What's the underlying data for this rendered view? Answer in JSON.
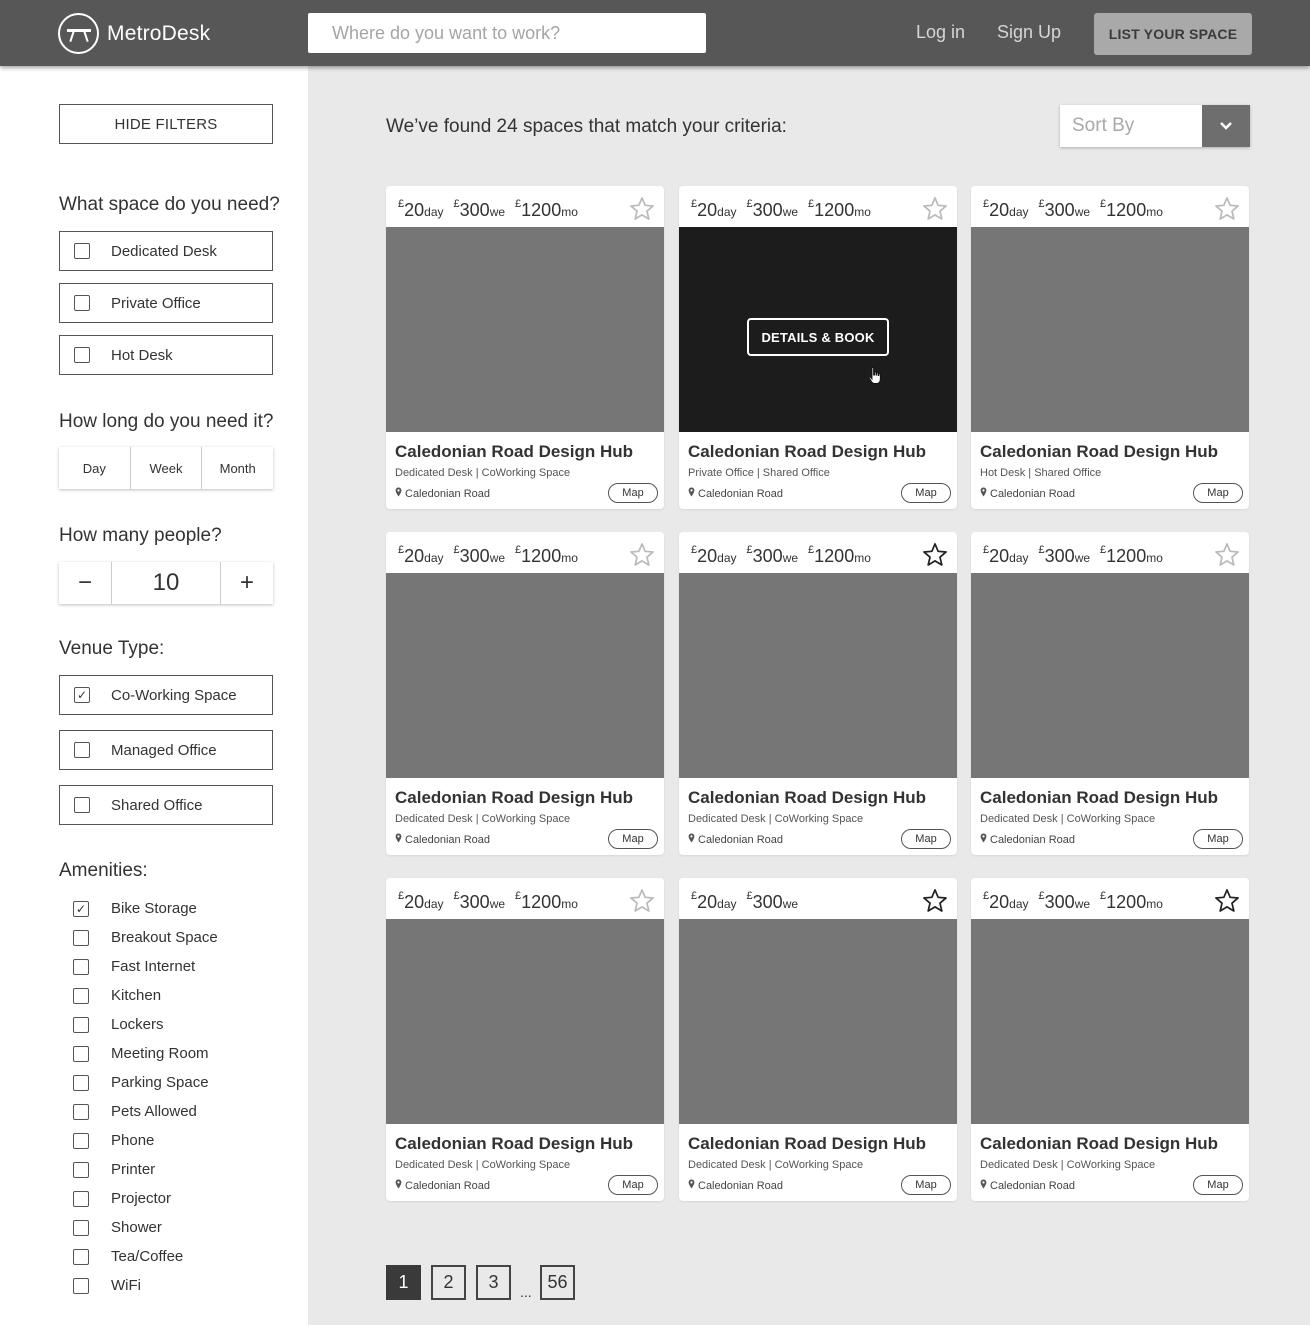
{
  "header": {
    "brand": "MetroDesk",
    "search_placeholder": "Where do you want to work?",
    "login_label": "Log in",
    "signup_label": "Sign Up",
    "list_space_label": "LIST YOUR SPACE"
  },
  "sidebar": {
    "hide_filters_label": "HIDE FILTERS",
    "space_title": "What space do you need?",
    "space_options": [
      {
        "label": "Dedicated Desk",
        "checked": false
      },
      {
        "label": "Private Office",
        "checked": false
      },
      {
        "label": "Hot Desk",
        "checked": false
      }
    ],
    "duration_title": "How long do you need it?",
    "duration_options": [
      "Day",
      "Week",
      "Month"
    ],
    "people_title": "How many people?",
    "people_minus": "−",
    "people_value": "10",
    "people_plus": "+",
    "venue_title": "Venue Type:",
    "venue_options": [
      {
        "label": "Co-Working Space",
        "checked": true
      },
      {
        "label": "Managed Office",
        "checked": false
      },
      {
        "label": "Shared Office",
        "checked": false
      }
    ],
    "amenities_title": "Amenities:",
    "amenities": [
      {
        "label": "Bike Storage",
        "checked": true
      },
      {
        "label": "Breakout Space",
        "checked": false
      },
      {
        "label": "Fast Internet",
        "checked": false
      },
      {
        "label": "Kitchen",
        "checked": false
      },
      {
        "label": "Lockers",
        "checked": false
      },
      {
        "label": "Meeting Room",
        "checked": false
      },
      {
        "label": "Parking Space",
        "checked": false
      },
      {
        "label": "Pets Allowed",
        "checked": false
      },
      {
        "label": "Phone",
        "checked": false
      },
      {
        "label": "Printer",
        "checked": false
      },
      {
        "label": "Projector",
        "checked": false
      },
      {
        "label": "Shower",
        "checked": false
      },
      {
        "label": "Tea/Coffee",
        "checked": false
      },
      {
        "label": "WiFi",
        "checked": false
      }
    ]
  },
  "main": {
    "results_heading": "We’ve found 24 spaces that match your criteria:",
    "sort_label": "Sort By",
    "cards": [
      {
        "title": "Caledonian Road Design Hub",
        "subtitle": "Dedicated Desk | CoWorking Space",
        "location": "Caledonian Road",
        "map_label": "Map",
        "starred": false,
        "hover": false,
        "prices": [
          {
            "currency": "£",
            "amount": "20",
            "unit": "day"
          },
          {
            "currency": "£",
            "amount": "300",
            "unit": "we"
          },
          {
            "currency": "£",
            "amount": "1200",
            "unit": "mo"
          }
        ]
      },
      {
        "title": "Caledonian Road Design Hub",
        "subtitle": "Private Office | Shared Office",
        "location": "Caledonian Road",
        "map_label": "Map",
        "starred": false,
        "hover": true,
        "details_label": "DETAILS & BOOK",
        "prices": [
          {
            "currency": "£",
            "amount": "20",
            "unit": "day"
          },
          {
            "currency": "£",
            "amount": "300",
            "unit": "we"
          },
          {
            "currency": "£",
            "amount": "1200",
            "unit": "mo"
          }
        ]
      },
      {
        "title": "Caledonian Road Design Hub",
        "subtitle": "Hot Desk | Shared Office",
        "location": "Caledonian Road",
        "map_label": "Map",
        "starred": false,
        "hover": false,
        "prices": [
          {
            "currency": "£",
            "amount": "20",
            "unit": "day"
          },
          {
            "currency": "£",
            "amount": "300",
            "unit": "we"
          },
          {
            "currency": "£",
            "amount": "1200",
            "unit": "mo"
          }
        ]
      },
      {
        "title": "Caledonian Road Design Hub",
        "subtitle": "Dedicated Desk | CoWorking Space",
        "location": "Caledonian Road",
        "map_label": "Map",
        "starred": false,
        "hover": false,
        "prices": [
          {
            "currency": "£",
            "amount": "20",
            "unit": "day"
          },
          {
            "currency": "£",
            "amount": "300",
            "unit": "we"
          },
          {
            "currency": "£",
            "amount": "1200",
            "unit": "mo"
          }
        ]
      },
      {
        "title": "Caledonian Road Design Hub",
        "subtitle": "Dedicated Desk | CoWorking Space",
        "location": "Caledonian Road",
        "map_label": "Map",
        "starred": true,
        "hover": false,
        "prices": [
          {
            "currency": "£",
            "amount": "20",
            "unit": "day"
          },
          {
            "currency": "£",
            "amount": "300",
            "unit": "we"
          },
          {
            "currency": "£",
            "amount": "1200",
            "unit": "mo"
          }
        ]
      },
      {
        "title": "Caledonian Road Design Hub",
        "subtitle": "Dedicated Desk | CoWorking Space",
        "location": "Caledonian Road",
        "map_label": "Map",
        "starred": false,
        "hover": false,
        "prices": [
          {
            "currency": "£",
            "amount": "20",
            "unit": "day"
          },
          {
            "currency": "£",
            "amount": "300",
            "unit": "we"
          },
          {
            "currency": "£",
            "amount": "1200",
            "unit": "mo"
          }
        ]
      },
      {
        "title": "Caledonian Road Design Hub",
        "subtitle": "Dedicated Desk | CoWorking Space",
        "location": "Caledonian Road",
        "map_label": "Map",
        "starred": false,
        "hover": false,
        "prices": [
          {
            "currency": "£",
            "amount": "20",
            "unit": "day"
          },
          {
            "currency": "£",
            "amount": "300",
            "unit": "we"
          },
          {
            "currency": "£",
            "amount": "1200",
            "unit": "mo"
          }
        ]
      },
      {
        "title": "Caledonian Road Design Hub",
        "subtitle": "Dedicated Desk | CoWorking Space",
        "location": "Caledonian Road",
        "map_label": "Map",
        "starred": true,
        "hover": false,
        "prices": [
          {
            "currency": "£",
            "amount": "20",
            "unit": "day"
          },
          {
            "currency": "£",
            "amount": "300",
            "unit": "we"
          }
        ]
      },
      {
        "title": "Caledonian Road Design Hub",
        "subtitle": "Dedicated Desk | CoWorking Space",
        "location": "Caledonian Road",
        "map_label": "Map",
        "starred": true,
        "hover": false,
        "prices": [
          {
            "currency": "£",
            "amount": "20",
            "unit": "day"
          },
          {
            "currency": "£",
            "amount": "300",
            "unit": "we"
          },
          {
            "currency": "£",
            "amount": "1200",
            "unit": "mo"
          }
        ]
      }
    ],
    "pagination": {
      "pages": [
        "1",
        "2",
        "3"
      ],
      "ellipsis": "...",
      "last_page": "56",
      "current": "1"
    }
  },
  "colors": {
    "header_bg": "#575757",
    "image_placeholder": "#767676",
    "image_hover": "#1c1c1c",
    "page_bg": "#e9e9e9"
  }
}
